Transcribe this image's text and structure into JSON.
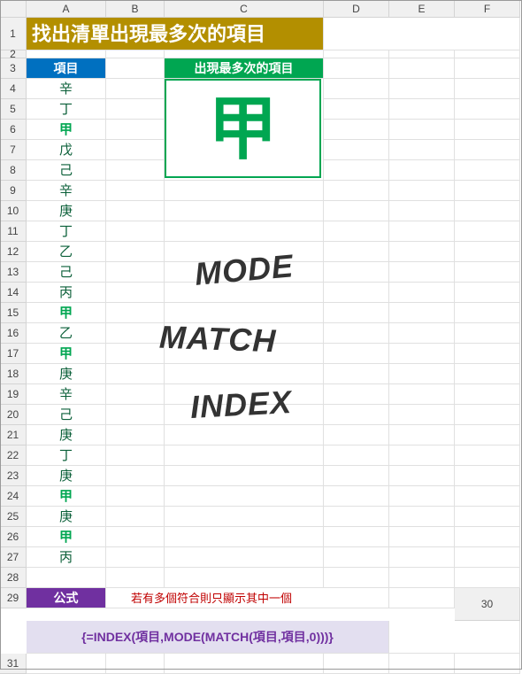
{
  "columns": [
    "A",
    "B",
    "C",
    "D",
    "E",
    "F"
  ],
  "title": "找出清單出現最多次的項目",
  "items_header": "項目",
  "result_header": "出現最多次的項目",
  "result_value": "甲",
  "items": [
    "辛",
    "丁",
    "甲",
    "戊",
    "己",
    "辛",
    "庚",
    "丁",
    "乙",
    "己",
    "丙",
    "甲",
    "乙",
    "甲",
    "庚",
    "辛",
    "己",
    "庚",
    "丁",
    "庚",
    "甲",
    "庚",
    "甲",
    "丙"
  ],
  "highlight_value": "甲",
  "formula_label": "公式",
  "note": "若有多個符合則只顯示其中一個",
  "formula": "{=INDEX(項目,MODE(MATCH(項目,項目,0)))}",
  "wordart": {
    "mode": "MODE",
    "match": "MATCH",
    "index": "INDEX"
  },
  "chart_data": {
    "type": "table",
    "title": "找出清單出現最多次的項目",
    "columns": [
      "項目"
    ],
    "rows": [
      [
        "辛"
      ],
      [
        "丁"
      ],
      [
        "甲"
      ],
      [
        "戊"
      ],
      [
        "己"
      ],
      [
        "辛"
      ],
      [
        "庚"
      ],
      [
        "丁"
      ],
      [
        "乙"
      ],
      [
        "己"
      ],
      [
        "丙"
      ],
      [
        "甲"
      ],
      [
        "乙"
      ],
      [
        "甲"
      ],
      [
        "庚"
      ],
      [
        "辛"
      ],
      [
        "己"
      ],
      [
        "庚"
      ],
      [
        "丁"
      ],
      [
        "庚"
      ],
      [
        "甲"
      ],
      [
        "庚"
      ],
      [
        "甲"
      ],
      [
        "丙"
      ]
    ],
    "result_label": "出現最多次的項目",
    "result": "甲",
    "formula": "{=INDEX(項目,MODE(MATCH(項目,項目,0)))}"
  }
}
